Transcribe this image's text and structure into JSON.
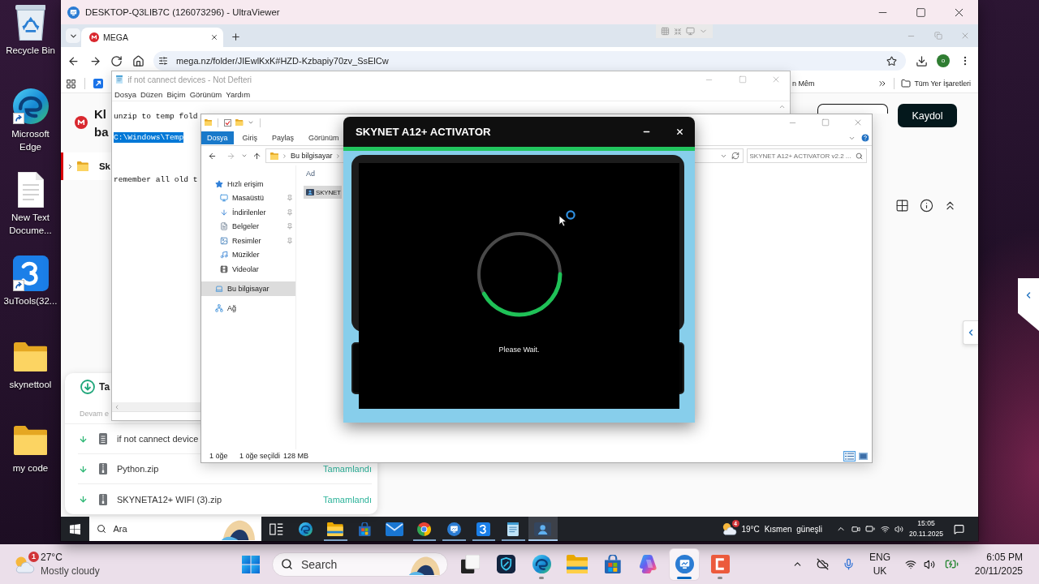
{
  "desktop": {
    "shortcuts": [
      {
        "label": "Recycle Bin",
        "kind": "recycle-bin",
        "shortcut": false
      },
      {
        "label": "Microsoft Edge",
        "kind": "edge",
        "shortcut": true
      },
      {
        "label": "New Text Docume...",
        "kind": "text-file",
        "shortcut": false
      },
      {
        "label": "3uTools(32...",
        "kind": "three-tools",
        "shortcut": true
      },
      {
        "label": "skynettool",
        "kind": "folder",
        "shortcut": false
      },
      {
        "label": "my code",
        "kind": "folder",
        "shortcut": false
      }
    ]
  },
  "remote_window": {
    "title": "DESKTOP-Q3LIB7C (126073296) - UltraViewer"
  },
  "browser": {
    "tabs": [
      {
        "label": "MEGA",
        "selected": true
      }
    ],
    "url": "mega.nz/folder/JIEwlKxK#HZD-Kzbapiy70zv_SsElCw",
    "profile": "o",
    "bookmarks": [
      {
        "label": "n Mêm"
      }
    ],
    "all_bookmarks": "Tüm Yer İşaretleri"
  },
  "mega_page": {
    "heading": "Kl\nba",
    "folder_row": "Sk",
    "signup_button": "Kaydol",
    "transfers": {
      "title": "Ta",
      "subtitle": "Devam e",
      "rows": [
        {
          "name": "if not cannect device",
          "kind": "text"
        },
        {
          "name": "Python.zip",
          "kind": "zip",
          "status": "Tamamlandı"
        },
        {
          "name": "SKYNETA12+ WIFI (3).zip",
          "kind": "zip",
          "status": "Tamamlandı"
        }
      ]
    }
  },
  "notepad": {
    "title": "if not cannect devices - Not Defteri",
    "menu": [
      "Dosya",
      "Düzen",
      "Biçim",
      "Görünüm",
      "Yardım"
    ],
    "paragraphs": [
      {
        "lines": [
          {
            "text": "unzip to temp fold",
            "selected": false
          },
          {
            "text": "C:\\Windows\\Temp",
            "selected": true
          }
        ]
      },
      {
        "lines": [
          {
            "text": "remember all old t",
            "selected": false
          }
        ]
      }
    ]
  },
  "explorer": {
    "ribbon_tabs": [
      {
        "label": "Dosya",
        "selected": true
      },
      {
        "label": "Giriş",
        "selected": false
      },
      {
        "label": "Paylaş",
        "selected": false
      },
      {
        "label": "Görünüm",
        "selected": false
      }
    ],
    "breadcrumb": [
      "Bu bilgisayar"
    ],
    "search": {
      "placeholder": "SKYNET A12+ ACTIVATOR v2.2 ..."
    },
    "nav": [
      {
        "label": "Hızlı erişim",
        "kind": "star",
        "selected": false,
        "children": [
          {
            "label": "Masaüstü",
            "kind": "desktop",
            "selected": false,
            "pinned": true
          },
          {
            "label": "İndirilenler",
            "kind": "downloads",
            "selected": false,
            "pinned": true
          },
          {
            "label": "Belgeler",
            "kind": "documents",
            "selected": false,
            "pinned": true
          },
          {
            "label": "Resimler",
            "kind": "pictures",
            "selected": false,
            "pinned": true
          },
          {
            "label": "Müzikler",
            "kind": "music",
            "selected": false,
            "pinned": false
          },
          {
            "label": "Videolar",
            "kind": "videos",
            "selected": false,
            "pinned": false
          }
        ]
      },
      {
        "label": "Bu bilgisayar",
        "kind": "computer",
        "selected": true
      },
      {
        "label": "Ağ",
        "kind": "network",
        "selected": false
      }
    ],
    "column_header": "Ad",
    "items": [
      {
        "name": "SKYNET",
        "selected": true
      }
    ],
    "status": {
      "count": "1 öğe",
      "selection": "1 öğe seçildi",
      "size": "128 MB"
    },
    "views": [
      {
        "kind": "details",
        "selected": true
      },
      {
        "kind": "large-icons",
        "selected": false
      }
    ]
  },
  "activator": {
    "title": "SKYNET A12+ ACTIVATOR",
    "message": "Please Wait."
  },
  "remote_taskbar": {
    "search": {
      "placeholder": "Ara"
    },
    "apps": [
      {
        "kind": "task-view",
        "running": false,
        "selected": false
      },
      {
        "kind": "edge",
        "running": false,
        "selected": false
      },
      {
        "kind": "explorer",
        "running": true,
        "selected": false
      },
      {
        "kind": "store",
        "running": false,
        "selected": false
      },
      {
        "kind": "mail",
        "running": false,
        "selected": false
      },
      {
        "kind": "chrome",
        "running": true,
        "selected": false
      },
      {
        "kind": "ultraviewer",
        "running": true,
        "selected": false
      },
      {
        "kind": "three-tools",
        "running": true,
        "selected": false
      },
      {
        "kind": "notepad",
        "running": true,
        "selected": false
      },
      {
        "kind": "activator",
        "running": true,
        "selected": true
      }
    ],
    "weather": {
      "badge": "4",
      "temperature": "19°C",
      "condition": "Kısmen güneşli"
    },
    "time": "15:05",
    "date": "20.11.2025"
  },
  "local_taskbar": {
    "weather": {
      "badge": "1",
      "temperature": "27°C",
      "condition": "Mostly cloudy"
    },
    "search": {
      "placeholder": "Search"
    },
    "apps": [
      {
        "kind": "stacked-squares",
        "running": false,
        "selected": false
      },
      {
        "kind": "shield",
        "running": false,
        "selected": false
      },
      {
        "kind": "edge",
        "running": true,
        "selected": false
      },
      {
        "kind": "explorer",
        "running": false,
        "selected": false
      },
      {
        "kind": "store",
        "running": false,
        "selected": false
      },
      {
        "kind": "copilot",
        "running": false,
        "selected": false
      },
      {
        "kind": "ultraviewer",
        "running": true,
        "selected": true
      },
      {
        "kind": "c-app",
        "running": true,
        "selected": false
      }
    ],
    "language": "ENG",
    "region": "UK",
    "time": "6:05 PM",
    "date": "20/11/2025"
  }
}
